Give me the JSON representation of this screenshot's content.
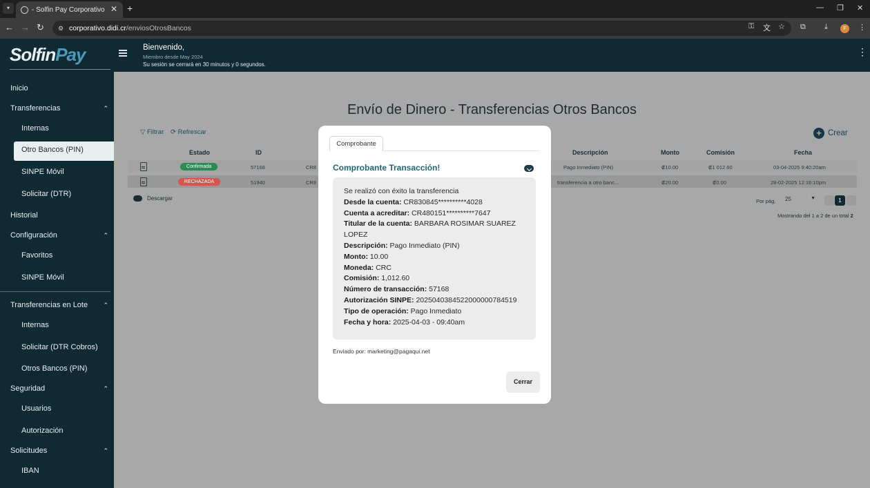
{
  "browser": {
    "tab_title": "- Solfin Pay Corporativo",
    "url_host": "corporativo.didi.cr",
    "url_path": "/enviosOtrosBancos",
    "profile_initial": "F"
  },
  "header": {
    "logo_part1": "Solfin",
    "logo_part2": "Pay",
    "welcome": "Bienvenido,",
    "member_since": "Miembro desde May 2024",
    "session_notice": "Su sesión se cerrará en 30 minutos y 0 segundos."
  },
  "sidebar": {
    "items": [
      {
        "label": "Inicio"
      },
      {
        "label": "Transferencias"
      },
      {
        "label": "Internas"
      },
      {
        "label": "Otro Bancos (PIN)"
      },
      {
        "label": "SINPE Móvil"
      },
      {
        "label": "Solicitar (DTR)"
      },
      {
        "label": "Historial"
      },
      {
        "label": "Configuración"
      },
      {
        "label": "Favoritos"
      },
      {
        "label": "SINPE Móvil"
      },
      {
        "label": "Transferencias en Lote"
      },
      {
        "label": "Internas"
      },
      {
        "label": "Solicitar (DTR Cobros)"
      },
      {
        "label": "Otros Bancos (PIN)"
      },
      {
        "label": "Seguridad"
      },
      {
        "label": "Usuarios"
      },
      {
        "label": "Autorización"
      },
      {
        "label": "Solicitudes"
      },
      {
        "label": "IBAN"
      }
    ]
  },
  "main": {
    "title": "Envío de Dinero - Transferencias Otros Bancos",
    "filter_label": "Filtrar",
    "refresh_label": "Refrescar",
    "create_label": "Crear",
    "columns": [
      "Estado",
      "ID",
      "Descripción",
      "Monto",
      "Comisión",
      "Fecha"
    ],
    "rows": [
      {
        "status": "Confirmada",
        "id": "57168",
        "acct": "CR8",
        "desc": "Pago Inmediato (PIN)",
        "amount": "₡10.00",
        "fee": "₡1 012.60",
        "date": "03-04-2025 9:40:20am"
      },
      {
        "status": "RECHAZADA",
        "id": "51940",
        "acct": "CR8",
        "desc": "transferencia a otro banc...",
        "amount": "₡20.00",
        "fee": "₡0.00",
        "date": "28-02-2025 12:16:10pm"
      }
    ],
    "download_label": "Descargar",
    "per_page_label": "Por pág.",
    "per_page_value": "25",
    "current_page": "1",
    "showing_prefix": "Mostrando del 1 a 2 de un total",
    "showing_total": "2"
  },
  "modal": {
    "tab_label": "Comprobante",
    "title": "Comprobante Transacción!",
    "success_msg": "Se realizó con éxito la transferencia",
    "fields": [
      {
        "label": "Desde la cuenta:",
        "value": "CR830845**********4028"
      },
      {
        "label": "Cuenta a acreditar:",
        "value": "CR480151**********7647"
      },
      {
        "label": "Titular de la cuenta:",
        "value": "BARBARA ROSIMAR SUAREZ LOPEZ"
      },
      {
        "label": "Descripción:",
        "value": "Pago Inmediato (PIN)"
      },
      {
        "label": "Monto:",
        "value": "10.00"
      },
      {
        "label": "Moneda:",
        "value": "CRC"
      },
      {
        "label": "Comisión:",
        "value": "1,012.60"
      },
      {
        "label": "Número de transacción:",
        "value": "57168"
      },
      {
        "label": "Autorización SINPE:",
        "value": "2025040384522000000784519"
      },
      {
        "label": "Tipo de operación:",
        "value": "Pago Inmediato"
      },
      {
        "label": "Fecha y hora:",
        "value": "2025-04-03 - 09:40am"
      }
    ],
    "sent_by": "Enviado por: marketing@pagaqui.net",
    "close_label": "Cerrar"
  },
  "colors": {
    "sidebar_bg": "#0f2a33",
    "accent": "#1d6777",
    "confirmed": "#2e8b57",
    "rejected": "#d9534f"
  }
}
